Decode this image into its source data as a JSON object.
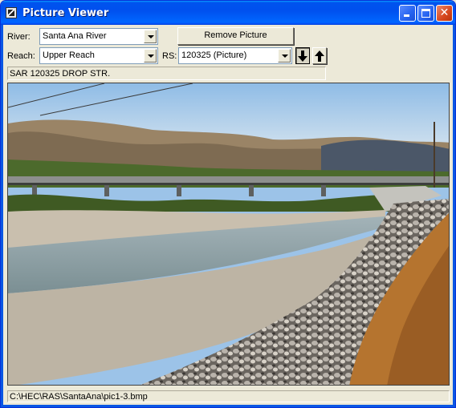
{
  "window": {
    "title": "Picture Viewer"
  },
  "controls": {
    "river_label": "River:",
    "river_value": "Santa Ana River",
    "reach_label": "Reach:",
    "reach_value": "Upper Reach",
    "rs_label": "RS:",
    "rs_value": "120325  (Picture)",
    "remove_button_label": "Remove Picture"
  },
  "picture": {
    "description": "SAR 120325 DROP STR.",
    "file_path": "C:\\HEC\\RAS\\SantaAna\\pic1-3.bmp"
  },
  "icons": {
    "down_arrow": "down-arrow-icon",
    "up_arrow": "up-arrow-icon",
    "app": "app-icon"
  },
  "colors": {
    "titlebar": "#0054e3",
    "window_bg": "#ece9d8",
    "close_button": "#d6461d"
  }
}
